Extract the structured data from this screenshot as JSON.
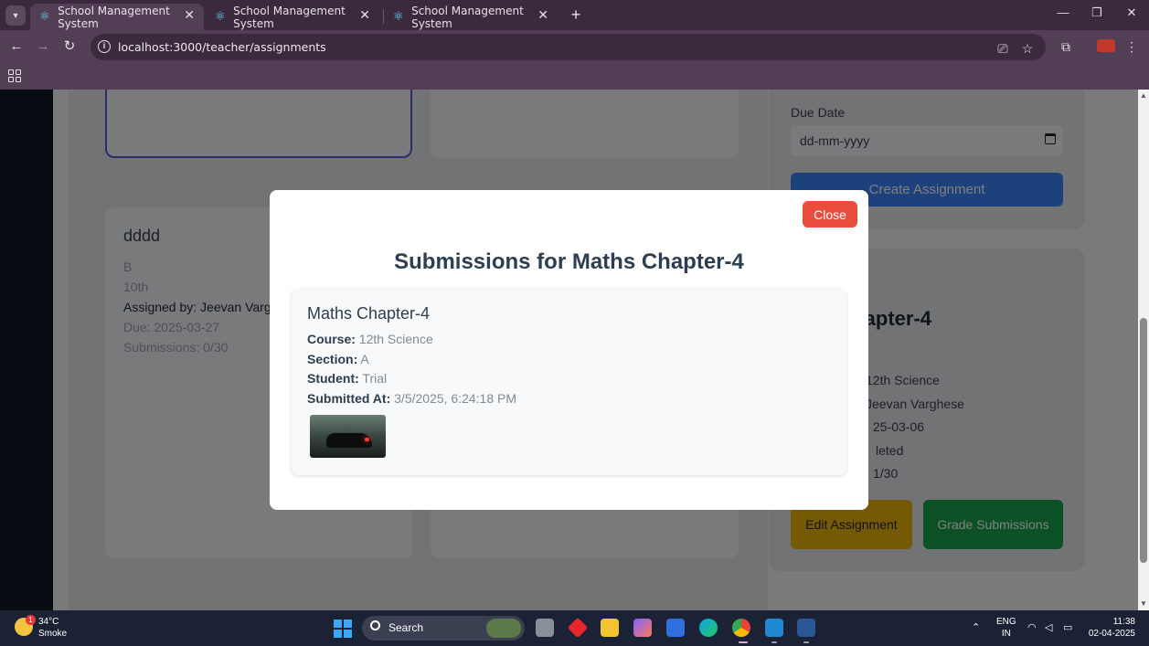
{
  "browser": {
    "tabs": [
      {
        "title": "School Management System",
        "active": true
      },
      {
        "title": "School Management System",
        "active": false
      },
      {
        "title": "School Management System",
        "active": false
      }
    ],
    "url": "localhost:3000/teacher/assignments"
  },
  "cards": {
    "left_card": {
      "title": "dddd",
      "section": "B",
      "course": "10th",
      "assigned_by": "Assigned by: Jeevan Varghe",
      "due": "Due: 2025-03-27",
      "submissions": "Submissions: 0/30"
    }
  },
  "form": {
    "due_label": "Due Date",
    "due_placeholder": "dd-mm-yyyy",
    "create_button": "Create Assignment"
  },
  "detail": {
    "title_partial": "aths Chapter-4",
    "lines": [
      "12th Science",
      "Jeevan Varghese",
      "25-03-06",
      "leted",
      "1/30"
    ],
    "edit_button": "Edit Assignment",
    "grade_button": "Grade Submissions"
  },
  "modal": {
    "close_button": "Close",
    "title": "Submissions for Maths Chapter-4",
    "submission": {
      "title": "Maths Chapter-4",
      "course_label": "Course:",
      "course": "12th Science",
      "section_label": "Section:",
      "section": "A",
      "student_label": "Student:",
      "student": "Trial",
      "submitted_label": "Submitted At:",
      "submitted_at": "3/5/2025, 6:24:18 PM"
    }
  },
  "taskbar": {
    "weather_temp": "34°C",
    "weather_desc": "Smoke",
    "weather_badge": "1",
    "search_label": "Search",
    "lang_line1": "ENG",
    "lang_line2": "IN",
    "time": "11:38",
    "date": "02-04-2025"
  }
}
